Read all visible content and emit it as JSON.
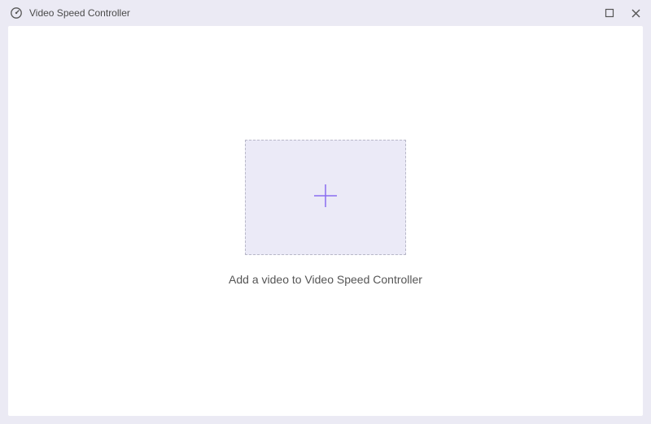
{
  "titlebar": {
    "app_title": "Video Speed Controller"
  },
  "main": {
    "instruction": "Add a video to Video Speed Controller"
  },
  "icons": {
    "app": "speed-gauge-icon",
    "maximize": "maximize-icon",
    "close": "close-icon",
    "plus": "plus-icon"
  }
}
